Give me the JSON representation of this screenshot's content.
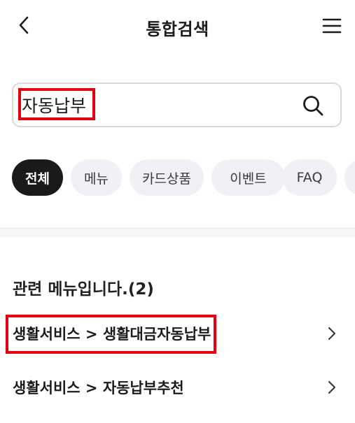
{
  "header": {
    "title": "통합검색",
    "back_icon": "chevron-left-icon",
    "menu_icon": "hamburger-menu-icon"
  },
  "search": {
    "value": "자동납부",
    "placeholder": "",
    "search_icon": "search-icon"
  },
  "chips": [
    {
      "label": "전체",
      "active": true
    },
    {
      "label": "메뉴",
      "active": false
    },
    {
      "label": "카드상품",
      "active": false
    },
    {
      "label": "이벤트",
      "active": false
    },
    {
      "label": "FAQ",
      "active": false
    }
  ],
  "results": {
    "section_title": "관련 메뉴입니다.(2)",
    "items": [
      {
        "label": "생활서비스 > 생활대금자동납부"
      },
      {
        "label": "생활서비스 > 자동납부추천"
      }
    ]
  },
  "colors": {
    "highlight": "#e3000f",
    "chip_active_bg": "#1a1a1a",
    "chip_bg": "#f0f1f4"
  }
}
